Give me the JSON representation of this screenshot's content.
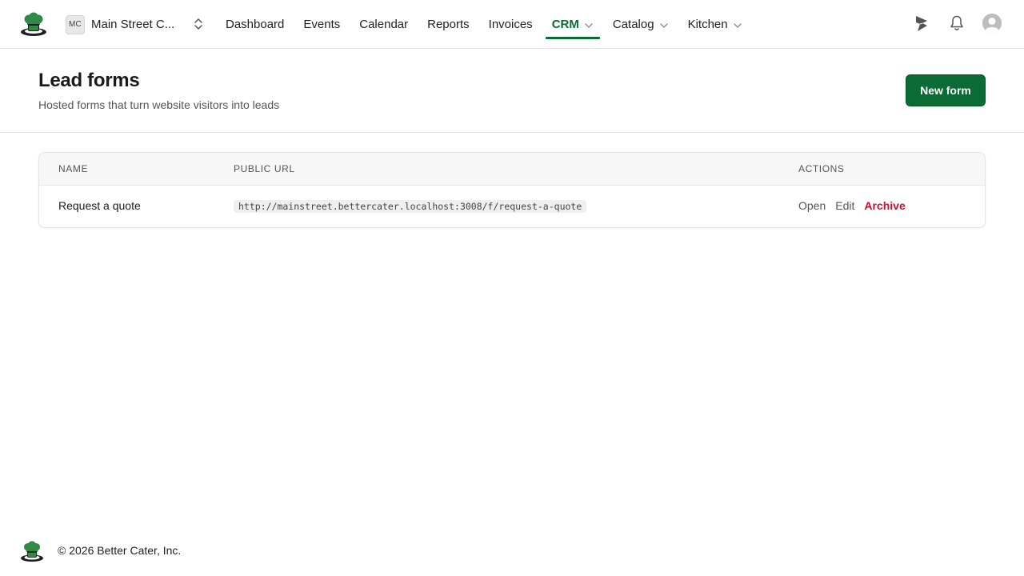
{
  "app": {
    "brand_colors": {
      "accent": "#0b6b35",
      "danger": "#c8102e"
    },
    "logo_icon": "chef-hat-logo"
  },
  "org": {
    "initials": "MC",
    "name": "Main Street C..."
  },
  "nav": {
    "items": [
      {
        "label": "Dashboard",
        "active": false,
        "dropdown": false
      },
      {
        "label": "Events",
        "active": false,
        "dropdown": false
      },
      {
        "label": "Calendar",
        "active": false,
        "dropdown": false
      },
      {
        "label": "Reports",
        "active": false,
        "dropdown": false
      },
      {
        "label": "Invoices",
        "active": false,
        "dropdown": false
      },
      {
        "label": "CRM",
        "active": true,
        "dropdown": true
      },
      {
        "label": "Catalog",
        "active": false,
        "dropdown": true
      },
      {
        "label": "Kitchen",
        "active": false,
        "dropdown": true
      }
    ]
  },
  "page": {
    "title": "Lead forms",
    "subtitle": "Hosted forms that turn website visitors into leads",
    "new_button": "New form"
  },
  "table": {
    "headers": {
      "name": "NAME",
      "url": "PUBLIC URL",
      "actions": "ACTIONS"
    },
    "rows": [
      {
        "name": "Request a quote",
        "url": "http://mainstreet.bettercater.localhost:3008/f/request-a-quote",
        "actions": {
          "open": "Open",
          "edit": "Edit",
          "archive": "Archive"
        }
      }
    ]
  },
  "footer": {
    "copyright": "© 2026 Better Cater, Inc."
  }
}
